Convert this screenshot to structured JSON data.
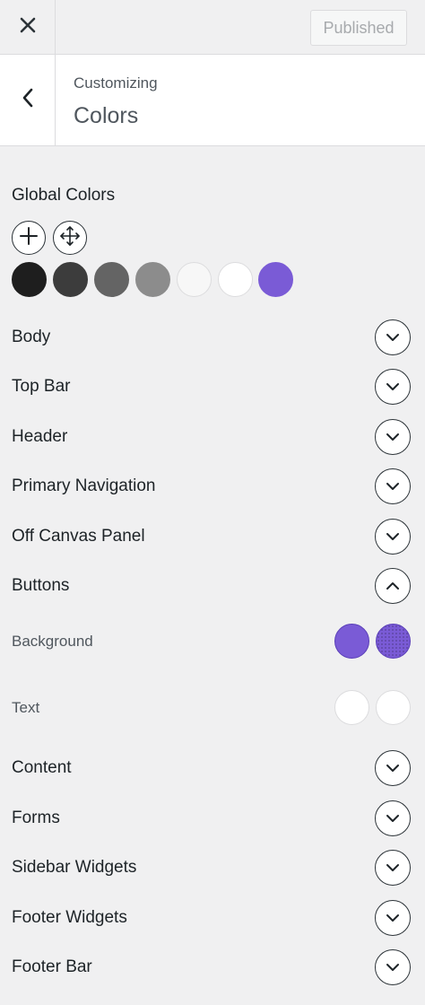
{
  "topbar": {
    "close_icon": "close-icon",
    "publish_label": "Published"
  },
  "header": {
    "back_icon": "chevron-left-icon",
    "subtitle": "Customizing",
    "title": "Colors"
  },
  "global_colors": {
    "title": "Global Colors",
    "tools": [
      "plus-icon",
      "move-icon"
    ],
    "swatches": [
      "#1e1e1e",
      "#3c3c3c",
      "#646464",
      "#8c8c8c",
      "#f7f7f7",
      "#ffffff",
      "#7a5bd6"
    ]
  },
  "sections": [
    {
      "label": "Body",
      "expanded": false
    },
    {
      "label": "Top Bar",
      "expanded": false
    },
    {
      "label": "Header",
      "expanded": false
    },
    {
      "label": "Primary Navigation",
      "expanded": false
    },
    {
      "label": "Off Canvas Panel",
      "expanded": false
    },
    {
      "label": "Buttons",
      "expanded": true
    },
    {
      "label": "Content",
      "expanded": false
    },
    {
      "label": "Forms",
      "expanded": false
    },
    {
      "label": "Sidebar Widgets",
      "expanded": false
    },
    {
      "label": "Footer Widgets",
      "expanded": false
    },
    {
      "label": "Footer Bar",
      "expanded": false
    }
  ],
  "buttons_settings": {
    "background": {
      "label": "Background",
      "colors": [
        "#7a5bd6",
        "#7a5bd6"
      ]
    },
    "text": {
      "label": "Text",
      "colors": [
        "#ffffff",
        "#ffffff"
      ]
    }
  }
}
